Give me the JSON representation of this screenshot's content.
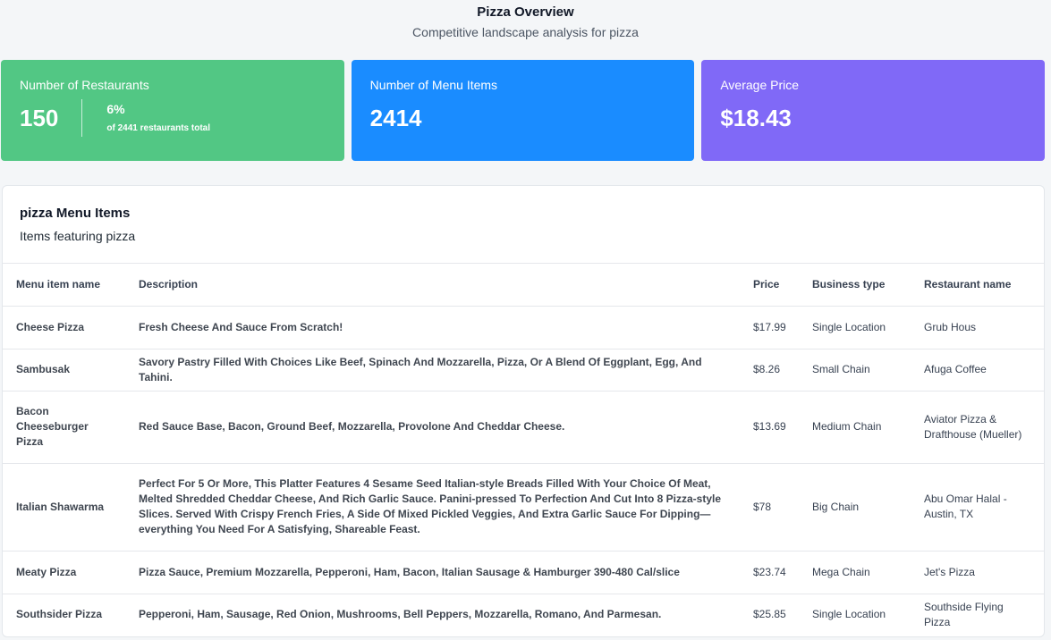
{
  "header": {
    "title": "Pizza Overview",
    "subtitle": "Competitive landscape analysis for pizza"
  },
  "cards": {
    "restaurants": {
      "title": "Number of Restaurants",
      "value": "150",
      "percent": "6%",
      "note": "of 2441 restaurants total",
      "color": "#52c784"
    },
    "menu_items": {
      "title": "Number of Menu Items",
      "value": "2414",
      "color": "#1a8cff"
    },
    "avg_price": {
      "title": "Average Price",
      "value": "$18.43",
      "color": "#8069f7"
    }
  },
  "panel": {
    "title": "pizza Menu Items",
    "subtitle": "Items featuring pizza"
  },
  "table": {
    "headers": {
      "name": "Menu item name",
      "description": "Description",
      "price": "Price",
      "business_type": "Business type",
      "restaurant": "Restaurant name"
    },
    "rows": [
      {
        "name": "Cheese Pizza",
        "description": "Fresh Cheese And Sauce From Scratch!",
        "price": "$17.99",
        "business_type": "Single Location",
        "restaurant": "Grub Hous"
      },
      {
        "name": "Sambusak",
        "description": "Savory Pastry Filled With Choices Like Beef, Spinach And Mozzarella, Pizza, Or A Blend Of Eggplant, Egg, And Tahini.",
        "price": "$8.26",
        "business_type": "Small Chain",
        "restaurant": "Afuga Coffee"
      },
      {
        "name": "Bacon Cheeseburger Pizza",
        "description": "Red Sauce Base, Bacon, Ground Beef, Mozzarella, Provolone And Cheddar Cheese.",
        "price": "$13.69",
        "business_type": "Medium Chain",
        "restaurant": "Aviator Pizza & Drafthouse (Mueller)"
      },
      {
        "name": "Italian Shawarma",
        "description": "Perfect For 5 Or More, This Platter Features 4 Sesame Seed Italian-style Breads Filled With Your Choice Of Meat, Melted Shredded Cheddar Cheese, And Rich Garlic Sauce. Panini-pressed To Perfection And Cut Into 8 Pizza-style Slices. Served With Crispy French Fries, A Side Of Mixed Pickled Veggies, And Extra Garlic Sauce For Dipping—everything You Need For A Satisfying, Shareable Feast.",
        "price": "$78",
        "business_type": "Big Chain",
        "restaurant": "Abu Omar Halal - Austin, TX"
      },
      {
        "name": "Meaty Pizza",
        "description": "Pizza Sauce, Premium Mozzarella, Pepperoni, Ham, Bacon, Italian Sausage & Hamburger 390-480 Cal/slice",
        "price": "$23.74",
        "business_type": "Mega Chain",
        "restaurant": "Jet's Pizza"
      },
      {
        "name": "Southsider Pizza",
        "description": "Pepperoni, Ham, Sausage, Red Onion, Mushrooms, Bell Peppers, Mozzarella, Romano, And Parmesan.",
        "price": "$25.85",
        "business_type": "Single Location",
        "restaurant": "Southside Flying Pizza"
      }
    ]
  }
}
